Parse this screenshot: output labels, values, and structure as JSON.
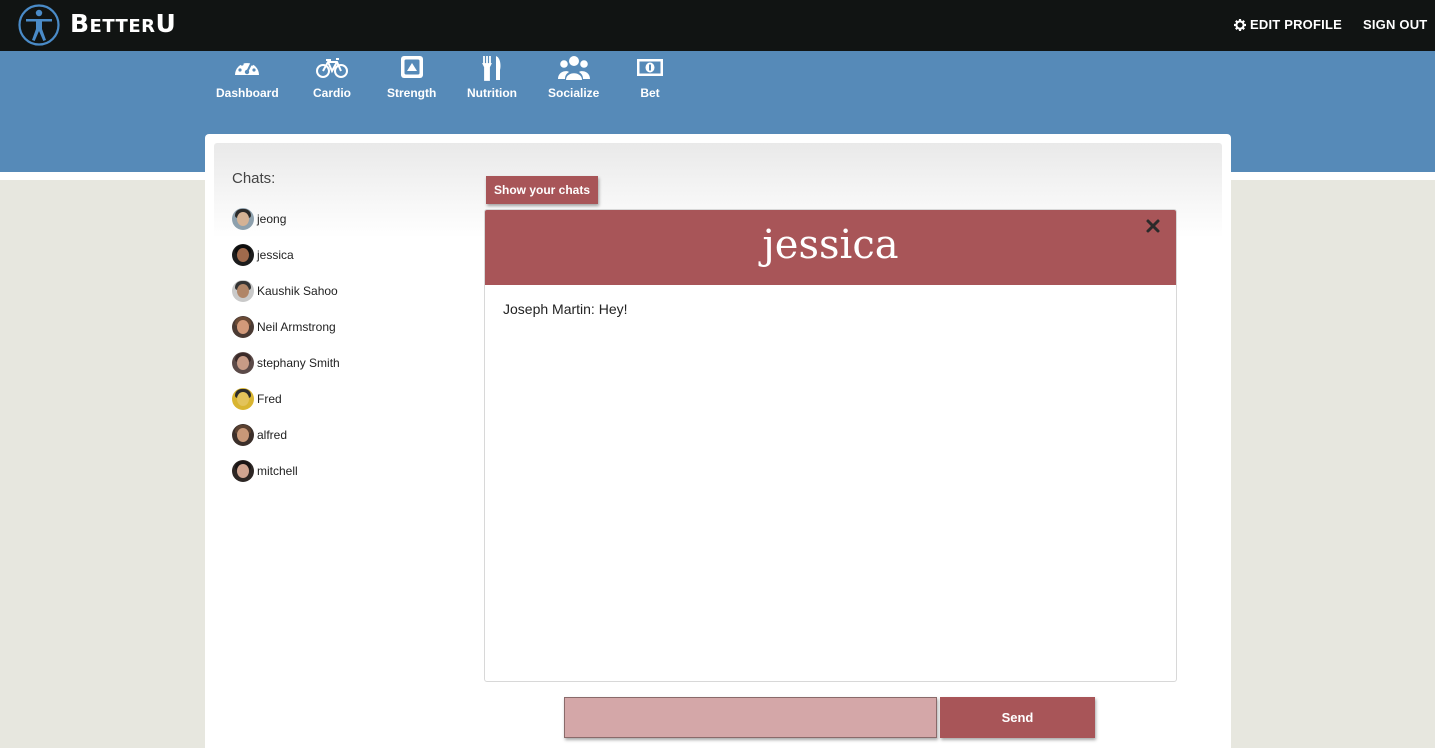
{
  "app": {
    "brand": "BetterU"
  },
  "topbar": {
    "edit_profile": "EDIT PROFILE",
    "sign_out": "SIGN OUT"
  },
  "nav": {
    "items": [
      {
        "label": "Dashboard",
        "icon": "dashboard-gauge-icon"
      },
      {
        "label": "Cardio",
        "icon": "bicycle-icon"
      },
      {
        "label": "Strength",
        "icon": "triangle-box-icon"
      },
      {
        "label": "Nutrition",
        "icon": "fork-knife-icon"
      },
      {
        "label": "Socialize",
        "icon": "users-icon"
      },
      {
        "label": "Bet",
        "icon": "money-bill-icon"
      }
    ]
  },
  "sidebar": {
    "title": "Chats:",
    "chats": [
      {
        "name": "jeong"
      },
      {
        "name": "jessica"
      },
      {
        "name": "Kaushik Sahoo"
      },
      {
        "name": "Neil Armstrong"
      },
      {
        "name": "stephany Smith"
      },
      {
        "name": "Fred"
      },
      {
        "name": "alfred"
      },
      {
        "name": "mitchell"
      }
    ]
  },
  "chat": {
    "show_chats_label": "Show your chats",
    "title": "jessica",
    "messages": [
      {
        "text": "Joseph Martin: Hey!"
      }
    ]
  },
  "composer": {
    "input_value": "",
    "send_label": "Send"
  },
  "colors": {
    "accent": "#a85558",
    "nav_blue": "#568ab8",
    "topbar": "#111413",
    "input_pink": "#d4a7a8"
  }
}
